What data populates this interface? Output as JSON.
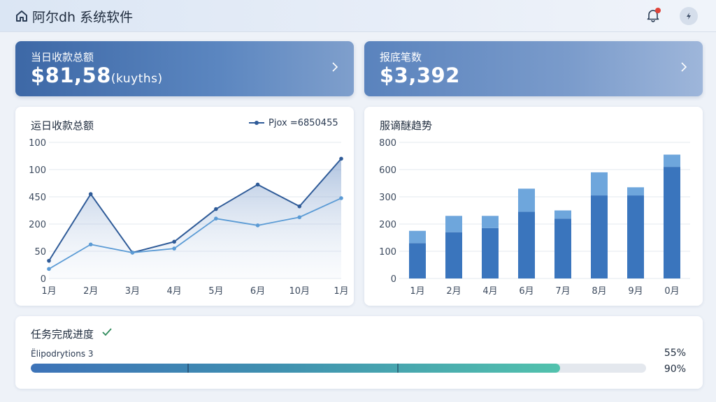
{
  "header": {
    "title": "阿尔dh 系统软件",
    "icons": [
      "home-icon",
      "bell-icon",
      "lightning-icon"
    ],
    "notification_dot_color": "#e0443a"
  },
  "kpis": [
    {
      "label": "当日收款总额",
      "value": "$81,58",
      "unit": "(kuyths)",
      "icon": "chevron-right-icon"
    },
    {
      "label": "报底笔数",
      "value": "$3,392",
      "unit": "",
      "icon": "chevron-right-icon"
    }
  ],
  "line_card": {
    "title": "运日收款总额",
    "legend_label": "Pjox =6850455",
    "colors": {
      "primary": "#2f5b98",
      "secondary": "#5b9bd5"
    }
  },
  "bar_card": {
    "title": "服谪醚趋势",
    "colors": {
      "base": "#3a75bd",
      "top": "#6ea6dc"
    }
  },
  "progress_card": {
    "title": "任务完成进度",
    "label": "Ëlipodrytions 3",
    "percent_top": "55%",
    "percent_bottom": "90%",
    "fill_fraction": 0.86,
    "segment_fractions": [
      0.255,
      0.595
    ]
  },
  "chart_data": [
    {
      "type": "line",
      "title": "运日收款总额",
      "categories": [
        "1月",
        "2月",
        "3月",
        "4月",
        "5月",
        "6月",
        "10月",
        "1月"
      ],
      "y_tick_labels": [
        "0",
        "50",
        "200",
        "450",
        "100",
        "100"
      ],
      "series": [
        {
          "name": "Pjox =6850455",
          "values": [
            0.13,
            0.62,
            0.19,
            0.27,
            0.51,
            0.69,
            0.53,
            0.88
          ]
        },
        {
          "values": [
            0.07,
            0.25,
            0.19,
            0.22,
            0.44,
            0.39,
            0.45,
            0.59
          ]
        }
      ],
      "grid": true,
      "legend": "top-right"
    },
    {
      "type": "bar",
      "title": "服谪醚趋势",
      "categories": [
        "1月",
        "2月",
        "4月",
        "6月",
        "7月",
        "8月",
        "9月",
        "0月"
      ],
      "y_tick_labels": [
        "0",
        "100",
        "200",
        "300",
        "600",
        "800"
      ],
      "series": [
        {
          "values": [
            0.26,
            0.34,
            0.37,
            0.49,
            0.44,
            0.61,
            0.61,
            0.82
          ]
        },
        {
          "values": [
            0.09,
            0.12,
            0.09,
            0.17,
            0.06,
            0.17,
            0.06,
            0.09
          ]
        }
      ],
      "stacked": true,
      "grid": true
    }
  ]
}
